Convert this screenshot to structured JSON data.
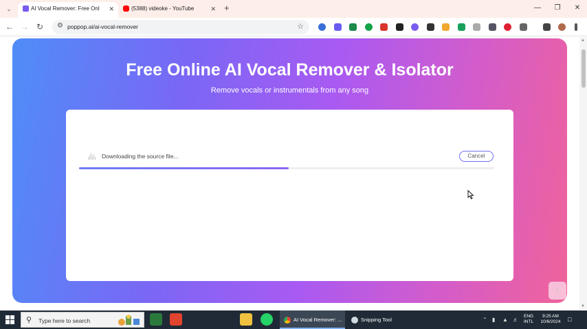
{
  "browser": {
    "tabs": [
      {
        "title": "AI Vocal Remover: Free Online",
        "active": true,
        "favicon_color": "#7b5cf0"
      },
      {
        "title": "(5388) videoke - YouTube",
        "active": false,
        "favicon_color": "#ff0000"
      }
    ],
    "url": "poppop.ai/ai-vocal-remover",
    "icons": {
      "tab_search": "chevron-down-icon",
      "new_tab": "plus-icon",
      "back": "arrow-left-icon",
      "forward": "arrow-right-icon",
      "reload": "reload-icon",
      "site_info": "tune-icon",
      "bookmark": "star-icon"
    }
  },
  "page": {
    "title": "Free Online AI Vocal Remover & Isolator",
    "subtitle": "Remove vocals or instrumentals from any song",
    "status_text": "Downloading the source file...",
    "cancel_label": "Cancel",
    "progress_fraction": 0.505,
    "gradient_colors": [
      "#4f8df8",
      "#a95af2",
      "#f0639a"
    ]
  },
  "taskbar": {
    "search_placeholder": "Type here to search",
    "tasks": [
      {
        "label": "AI Vocal Remover: ...",
        "active": true
      },
      {
        "label": "Snipping Tool",
        "active": false
      }
    ],
    "language": {
      "line1": "ENG",
      "line2": "INTL"
    },
    "clock": {
      "time": "9:25 AM",
      "date": "10/6/2024"
    }
  }
}
